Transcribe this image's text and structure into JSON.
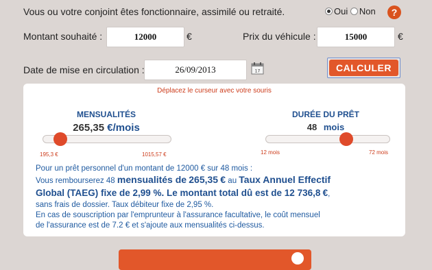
{
  "status_question": {
    "label": "Vous ou votre conjoint êtes fonctionnaire, assimilé ou retraité.",
    "option_yes": "Oui",
    "option_no": "Non",
    "selected": "Oui",
    "help_glyph": "?"
  },
  "amount": {
    "label": "Montant souhaité :",
    "value": "12000",
    "currency": "€"
  },
  "vehicle_price": {
    "label": "Prix du véhicule :",
    "value": "15000",
    "currency": "€"
  },
  "circulation_date": {
    "label": "Date de mise en circulation :",
    "value": "26/09/2013"
  },
  "calculate_button": {
    "label": "CALCULER"
  },
  "simulator": {
    "hint": "Déplacez le curseur avec votre souris",
    "monthly": {
      "title": "MENSUALITÉS",
      "value": "265,35",
      "unit": "€/mois",
      "min_label": "195,3 €",
      "max_label": "1015,57 €",
      "slider_fraction": 0.086
    },
    "duration": {
      "title": "DURÉE DU PRÊT",
      "value": "48",
      "unit": "mois",
      "min_label": "12 mois",
      "max_label": "72 mois",
      "slider_fraction": 0.6
    }
  },
  "summary": {
    "line1_a": "Pour un prêt personnel d'un montant de 12000",
    "line1_b": "€ sur 48",
    "line1_c": "mois :",
    "line2_a": "Vous rembourserez 48",
    "line2_b": "mensualités de",
    "line2_c": "265,35",
    "line2_d": "€",
    "line2_e": "au",
    "line2_f": "Taux Annuel Effectif",
    "line3": "Global (TAEG) fixe de 2,99 %. Le montant total dû est de 12 736,8",
    "line3_currency": "€",
    "line3_end": ",",
    "line4": "sans frais de dossier. Taux débiteur fixe de 2,95 %.",
    "line5": "En cas de souscription par l'emprunteur à l'assurance facultative, le coût mensuel",
    "line6": "de l'assurance est de 7.2",
    "line6_b": "€ et s'ajoute aux mensualités ci-dessus."
  },
  "colors": {
    "accent": "#e2572a",
    "title_blue": "#1f4f8f",
    "text_blue": "#1f5aa0",
    "background": "#dcd6d3"
  },
  "icons": [
    "help-icon",
    "calendar-icon",
    "arrow-right-icon"
  ]
}
